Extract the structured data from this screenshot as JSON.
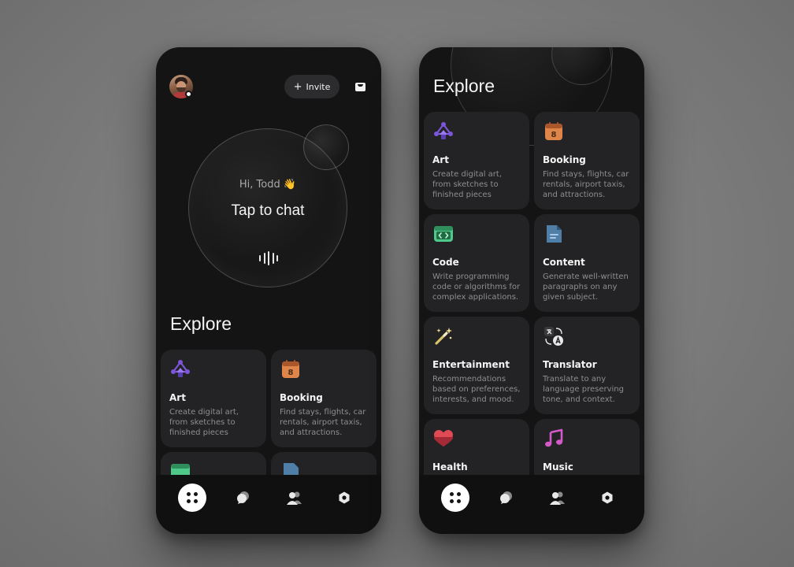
{
  "phone1": {
    "header": {
      "invite_label": "Invite",
      "invite_plus": "+"
    },
    "hero": {
      "greeting": "Hi, Todd 👋",
      "cta": "Tap to chat"
    },
    "explore_title": "Explore",
    "cards": [
      {
        "title": "Art",
        "description": "Create digital art, from sketches to finished pieces",
        "icon": "art-icon"
      },
      {
        "title": "Booking",
        "description": "Find stays, flights, car rentals, airport taxis, and attractions.",
        "icon": "calendar-icon",
        "badge": "8"
      }
    ]
  },
  "phone2": {
    "explore_title": "Explore",
    "cards": [
      {
        "title": "Art",
        "description": "Create digital art, from sketches to finished pieces",
        "icon": "art-icon"
      },
      {
        "title": "Booking",
        "description": "Find stays, flights, car rentals, airport taxis, and attractions.",
        "icon": "calendar-icon",
        "badge": "8"
      },
      {
        "title": "Code",
        "description": "Write programming code or algorithms for complex applications.",
        "icon": "code-icon"
      },
      {
        "title": "Content",
        "description": "Generate well-written paragraphs on any given subject.",
        "icon": "document-icon"
      },
      {
        "title": "Entertainment",
        "description": "Recommendations based on preferences, interests, and mood.",
        "icon": "magic-wand-icon"
      },
      {
        "title": "Translator",
        "description": "Translate to any language preserving tone, and context.",
        "icon": "translate-icon"
      },
      {
        "title": "Health",
        "description": "",
        "icon": "heart-icon"
      },
      {
        "title": "Music",
        "description": "",
        "icon": "music-note-icon"
      }
    ]
  },
  "nav": [
    "home-icon",
    "chat-icon",
    "users-icon",
    "settings-icon"
  ],
  "colors": {
    "background": "#7b7b7b",
    "phone": "#141414",
    "card": "#232325",
    "art_purple": "#7c55d9",
    "booking_orange": "#e0854a",
    "code_green": "#4fc98a",
    "content_blue": "#4f7ea6",
    "health_red": "#e04a55",
    "music_pink": "#d55ac9"
  }
}
